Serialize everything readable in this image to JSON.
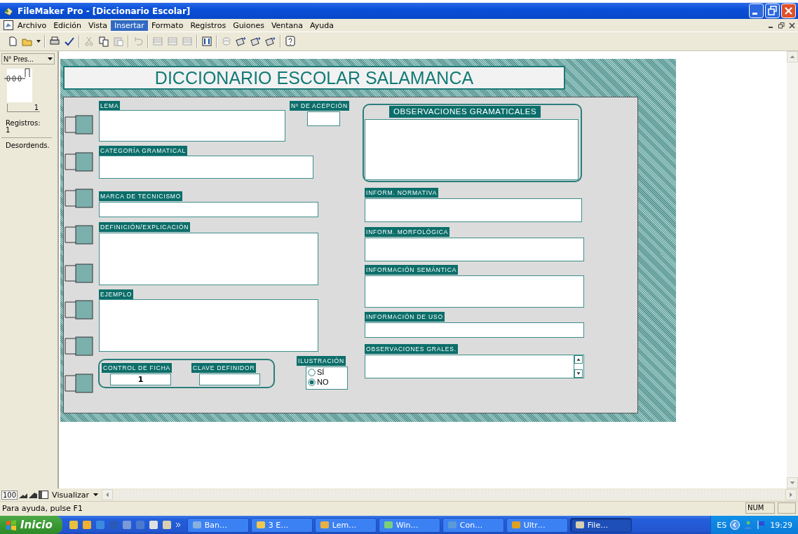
{
  "window": {
    "title": "FileMaker Pro - [Diccionario Escolar]"
  },
  "menu": [
    {
      "label": "Archivo",
      "selected": false
    },
    {
      "label": "Edición",
      "selected": false
    },
    {
      "label": "Vista",
      "selected": false
    },
    {
      "label": "Insertar",
      "selected": true
    },
    {
      "label": "Formato",
      "selected": false
    },
    {
      "label": "Registros",
      "selected": false
    },
    {
      "label": "Guiones",
      "selected": false
    },
    {
      "label": "Ventana",
      "selected": false
    },
    {
      "label": "Ayuda",
      "selected": false
    }
  ],
  "status_area": {
    "layout_menu": "N° Pres...",
    "record": "1",
    "records_label": "Registros:",
    "records_count": "1",
    "sort_state": "Desordends."
  },
  "layout": {
    "title": "DICCIONARIO ESCOLAR SALAMANCA",
    "fields": [
      {
        "label": "LEMA",
        "kind": "plain"
      },
      {
        "label": "Nº DE ACEPCIÓN",
        "kind": "plain"
      },
      {
        "label": "OBSERVACIONES GRAMATICALES",
        "kind": "framed"
      },
      {
        "label": "CATEGORÍA GRAMATICAL",
        "kind": "plain"
      },
      {
        "label": "MARCA DE TECNICISMO",
        "kind": "plain"
      },
      {
        "label": "DEFINICIÓN/EXPLICACIÓN",
        "kind": "plain"
      },
      {
        "label": "EJEMPLO",
        "kind": "plain"
      },
      {
        "label": "INFORM. NORMATIVA",
        "kind": "plain"
      },
      {
        "label": "INFORM. MORFOLÓGICA",
        "kind": "plain"
      },
      {
        "label": "INFORMACIÓN SEMÁNTICA",
        "kind": "plain"
      },
      {
        "label": "INFORMACIÓN DE USO",
        "kind": "plain"
      },
      {
        "label": "OBSERVACIONES GRALES.",
        "kind": "scrolling"
      }
    ],
    "control_group": [
      {
        "label": "CONTROL DE FICHA",
        "value": "1"
      },
      {
        "label": "CLAVE DEFINIDOR"
      }
    ],
    "illustration": {
      "label": "ILUSTRACIÓN",
      "options": [
        {
          "label": "SÍ",
          "selected": false
        },
        {
          "label": "NO",
          "selected": true
        }
      ]
    }
  },
  "zoom": "100",
  "mode_menu": "Visualizar",
  "status_bar": {
    "help": "Para ayuda, pulse F1",
    "indicator": "NUM"
  },
  "taskbar": {
    "start": "Inicio",
    "tasks": [
      {
        "label": "Ban…",
        "selected": false
      },
      {
        "label": "3 E…",
        "selected": false
      },
      {
        "label": "Lem…",
        "selected": false
      },
      {
        "label": "Win…",
        "selected": false
      },
      {
        "label": "Con…",
        "selected": false
      },
      {
        "label": "Ultr…",
        "selected": false
      },
      {
        "label": "File…",
        "selected": true
      }
    ],
    "language": "ES",
    "clock": "19:29"
  }
}
